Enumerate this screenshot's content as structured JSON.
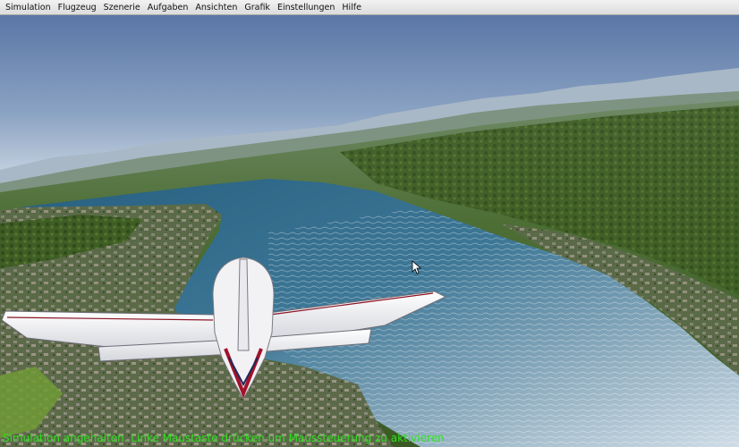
{
  "menubar": {
    "items": [
      {
        "label": "Simulation"
      },
      {
        "label": "Flugzeug"
      },
      {
        "label": "Szenerie"
      },
      {
        "label": "Aufgaben"
      },
      {
        "label": "Ansichten"
      },
      {
        "label": "Grafik"
      },
      {
        "label": "Einstellungen"
      },
      {
        "label": "Hilfe"
      }
    ]
  },
  "status": {
    "message": "Simulation angehalten. Linke Maustaste drücken um Maussteuerung zu aktivieren"
  },
  "colors": {
    "menubar_bg": "#e6e6e6",
    "status_text": "#2fe11f",
    "sky_top": "#5a76a6",
    "sky_horizon": "#d6dfe8",
    "lake": "#2f6e92",
    "aircraft_body": "#f2f2f4",
    "aircraft_stripe": "#a3122b"
  },
  "icons": [
    "mouse-cursor-icon"
  ]
}
